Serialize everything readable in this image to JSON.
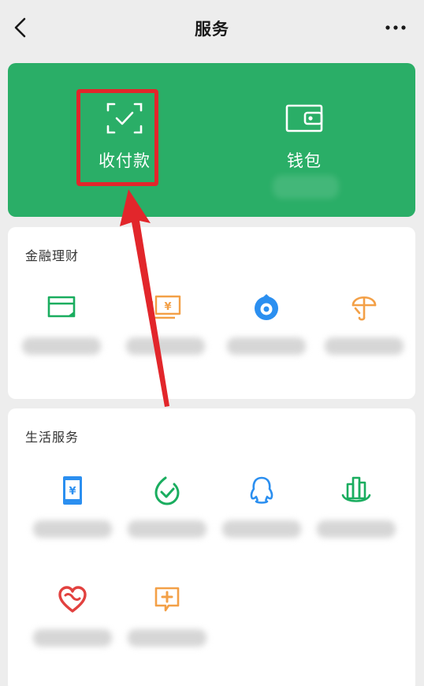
{
  "header": {
    "title": "服务"
  },
  "payments": {
    "pay_label": "收付款",
    "wallet_label": "钱包",
    "pay_icon": "scan-check-icon",
    "wallet_icon": "wallet-icon"
  },
  "finance": {
    "title": "金融理财",
    "items": [
      {
        "icon": "card-icon",
        "label": "",
        "color": "#1aad5f"
      },
      {
        "icon": "money-icon",
        "label": "",
        "color": "#f3a047"
      },
      {
        "icon": "fund-icon",
        "label": "",
        "color": "#2b8ff0"
      },
      {
        "icon": "insurance-icon",
        "label": "",
        "color": "#f3a047"
      }
    ]
  },
  "life": {
    "title": "生活服务",
    "items": [
      {
        "icon": "phone-recharge-icon",
        "label": "",
        "color": "#2b8ff0"
      },
      {
        "icon": "utilities-icon",
        "label": "",
        "color": "#1aad5f"
      },
      {
        "icon": "qq-icon",
        "label": "",
        "color": "#2b8ff0"
      },
      {
        "icon": "city-icon",
        "label": "",
        "color": "#1aad5f"
      },
      {
        "icon": "charity-icon",
        "label": "",
        "color": "#e2413f"
      },
      {
        "icon": "healthcare-icon",
        "label": "",
        "color": "#f3a047"
      }
    ]
  },
  "colors": {
    "brand_green": "#2aae67",
    "highlight_red": "#e2262b"
  }
}
